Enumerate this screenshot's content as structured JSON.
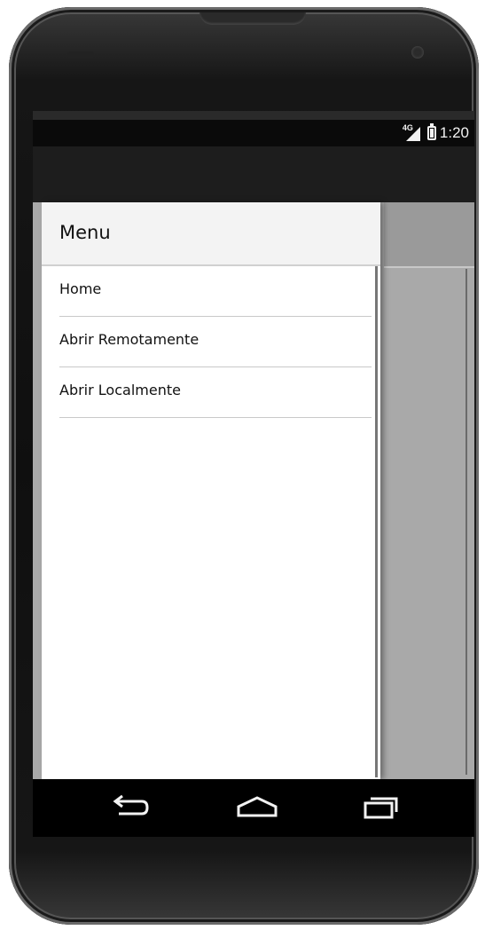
{
  "status_bar": {
    "network_type": "4G",
    "time": "1:20"
  },
  "drawer": {
    "title": "Menu",
    "items": [
      {
        "label": "Home"
      },
      {
        "label": "Abrir Remotamente"
      },
      {
        "label": "Abrir Localmente"
      }
    ]
  },
  "nav_bar": {
    "buttons": [
      "back-icon",
      "home-icon",
      "recent-apps-icon"
    ]
  },
  "colors": {
    "status_bar": "#0a0a0a",
    "action_bar": "#1d1d1d",
    "drawer_background": "#ffffff",
    "header_background": "#f3f3f3",
    "scrim": "#a9a9a9"
  }
}
